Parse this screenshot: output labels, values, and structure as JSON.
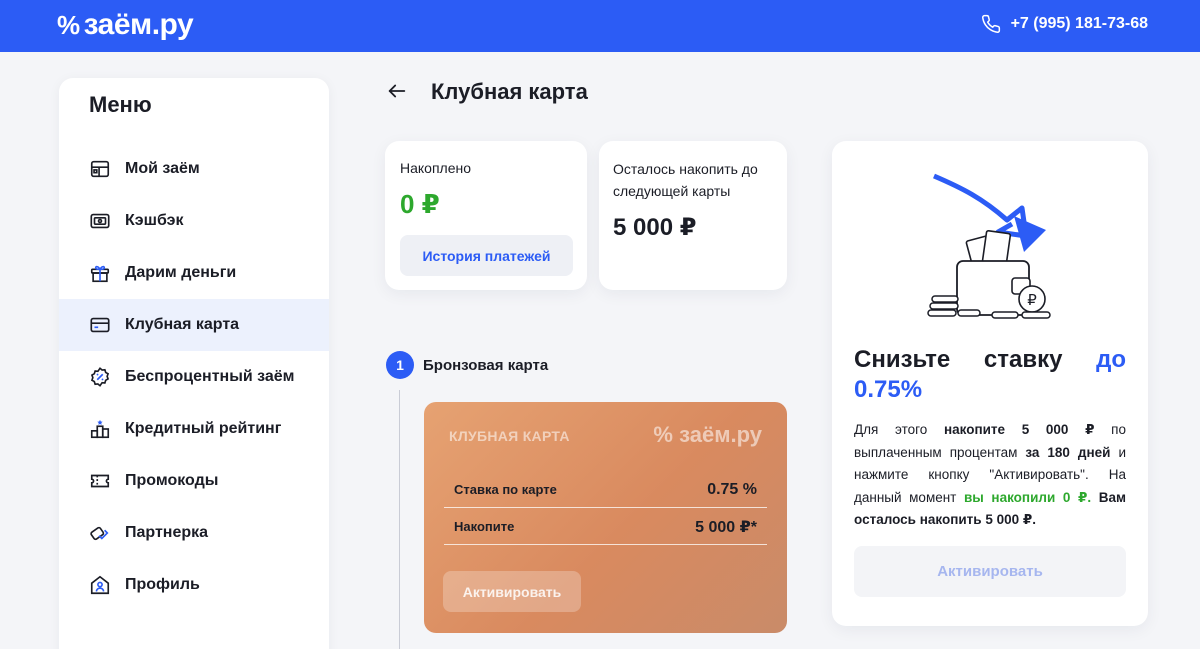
{
  "header": {
    "logo_text": "заём.ру",
    "logo_mark": "%",
    "phone": "+7 (995) 181-73-68"
  },
  "sidebar": {
    "title": "Меню",
    "items": [
      {
        "label": "Мой заём",
        "icon": "loan-icon"
      },
      {
        "label": "Кэшбэк",
        "icon": "cashback-icon"
      },
      {
        "label": "Дарим деньги",
        "icon": "gift-icon"
      },
      {
        "label": "Клубная карта",
        "icon": "card-icon"
      },
      {
        "label": "Беспроцентный заём",
        "icon": "percent-badge-icon"
      },
      {
        "label": "Кредитный рейтинг",
        "icon": "rating-icon"
      },
      {
        "label": "Промокоды",
        "icon": "ticket-icon"
      },
      {
        "label": "Партнерка",
        "icon": "handshake-icon"
      },
      {
        "label": "Профиль",
        "icon": "profile-icon"
      }
    ],
    "active_index": 3
  },
  "page": {
    "title": "Клубная карта"
  },
  "accumulated": {
    "label": "Накоплено",
    "value": "0 ₽",
    "button": "История платежей"
  },
  "remaining": {
    "label": "Осталось накопить до следующей карты",
    "value": "5 000 ₽"
  },
  "step": {
    "number": "1",
    "title": "Бронзовая карта"
  },
  "club_card": {
    "title": "КЛУБНАЯ КАРТА",
    "logo": "заём.ру",
    "rows": [
      {
        "label": "Ставка по карте",
        "value": "0.75 %"
      },
      {
        "label": "Накопите",
        "value": "5 000 ₽*"
      }
    ],
    "button": "Активировать"
  },
  "promo": {
    "title_line1": "Снизьте ставку",
    "title_accent": "до",
    "title_line2": "0.75%",
    "text_1": "Для этого ",
    "text_2": "накопите 5 000 ₽",
    "text_3": " по выплаченным процентам ",
    "text_4": "за 180 дней",
    "text_5": " и нажмите кнопку \"Активировать\". На данный момент ",
    "text_6": "вы накопили 0 ₽.",
    "text_7": " Вам осталось накопить 5 000 ₽.",
    "button": "Активировать"
  },
  "colors": {
    "brand_blue": "#2c5cf5",
    "green": "#2da82d",
    "card_orange": "#d98a5f"
  }
}
